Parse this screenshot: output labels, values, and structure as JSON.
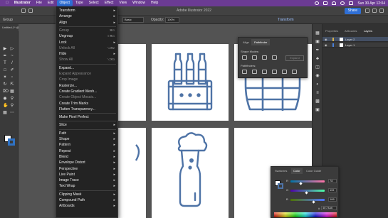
{
  "menubar": {
    "app": "Illustrator",
    "items": [
      "File",
      "Edit",
      "Object",
      "Type",
      "Select",
      "Effect",
      "View",
      "Window",
      "Help"
    ],
    "active": "Object",
    "datetime": "Sun 30 Apr 12:04"
  },
  "app": {
    "title": "Adobe Illustrator 2022",
    "share_label": "Share",
    "group_label": "Group",
    "doc_tab": "Untitled-1* @ 8.15 % (RGB/Preview)"
  },
  "control_bar": {
    "stroke_style": "Basic",
    "opacity_label": "Opacity:",
    "opacity_value": "100%",
    "transform_label": "Transform"
  },
  "object_menu": {
    "items": [
      {
        "label": "Transform",
        "submenu": true
      },
      {
        "label": "Arrange",
        "submenu": true
      },
      {
        "label": "Align",
        "submenu": true
      },
      {
        "sep": true
      },
      {
        "label": "Group",
        "disabled": true,
        "shortcut": "⌘G"
      },
      {
        "label": "Ungroup",
        "shortcut": "⇧⌘G"
      },
      {
        "label": "Lock",
        "submenu": true
      },
      {
        "label": "Unlock All",
        "disabled": true,
        "shortcut": "⌥⌘2"
      },
      {
        "label": "Hide",
        "submenu": true
      },
      {
        "label": "Show All",
        "disabled": true,
        "shortcut": "⌥⌘3"
      },
      {
        "sep": true
      },
      {
        "label": "Expand..."
      },
      {
        "label": "Expand Appearance",
        "disabled": true
      },
      {
        "label": "Crop Image",
        "disabled": true
      },
      {
        "label": "Rasterize..."
      },
      {
        "label": "Create Gradient Mesh..."
      },
      {
        "label": "Create Object Mosaic...",
        "disabled": true
      },
      {
        "label": "Create Trim Marks"
      },
      {
        "label": "Flatten Transparency..."
      },
      {
        "sep": true
      },
      {
        "label": "Make Pixel Perfect"
      },
      {
        "sep": true
      },
      {
        "label": "Slice",
        "submenu": true
      },
      {
        "sep": true
      },
      {
        "label": "Path",
        "submenu": true
      },
      {
        "label": "Shape",
        "submenu": true
      },
      {
        "label": "Pattern",
        "submenu": true
      },
      {
        "label": "Repeat",
        "submenu": true
      },
      {
        "label": "Blend",
        "submenu": true
      },
      {
        "label": "Envelope Distort",
        "submenu": true
      },
      {
        "label": "Perspective",
        "submenu": true
      },
      {
        "label": "Live Paint",
        "submenu": true
      },
      {
        "label": "Image Trace",
        "submenu": true
      },
      {
        "label": "Text Wrap",
        "submenu": true
      },
      {
        "sep": true
      },
      {
        "label": "Clipping Mask",
        "submenu": true
      },
      {
        "label": "Compound Path",
        "submenu": true
      },
      {
        "label": "Artboards",
        "submenu": true
      }
    ]
  },
  "pathfinder": {
    "tabs": [
      "Align",
      "Pathfinder"
    ],
    "active_tab": "Pathfinder",
    "shape_modes_label": "Shape Modes:",
    "pathfinders_label": "Pathfinders:",
    "expand_label": "Expand"
  },
  "right_panel": {
    "tabs": [
      "Properties",
      "Artboards",
      "Layers"
    ],
    "active_tab": "Layers",
    "layers": [
      {
        "name": "Layer 2",
        "color": "#d9b24a",
        "selected": true
      },
      {
        "name": "Layer 1",
        "color": "#4a7fd9",
        "selected": false
      }
    ]
  },
  "color_panel": {
    "tabs": [
      "Swatches",
      "Color",
      "Color Guide"
    ],
    "active_tab": "Color",
    "channels": [
      {
        "label": "R",
        "value": "78"
      },
      {
        "label": "G",
        "value": "115"
      },
      {
        "label": "B",
        "value": "166"
      }
    ],
    "hex": "4E73A6"
  },
  "icon_color": "#4e73a6"
}
